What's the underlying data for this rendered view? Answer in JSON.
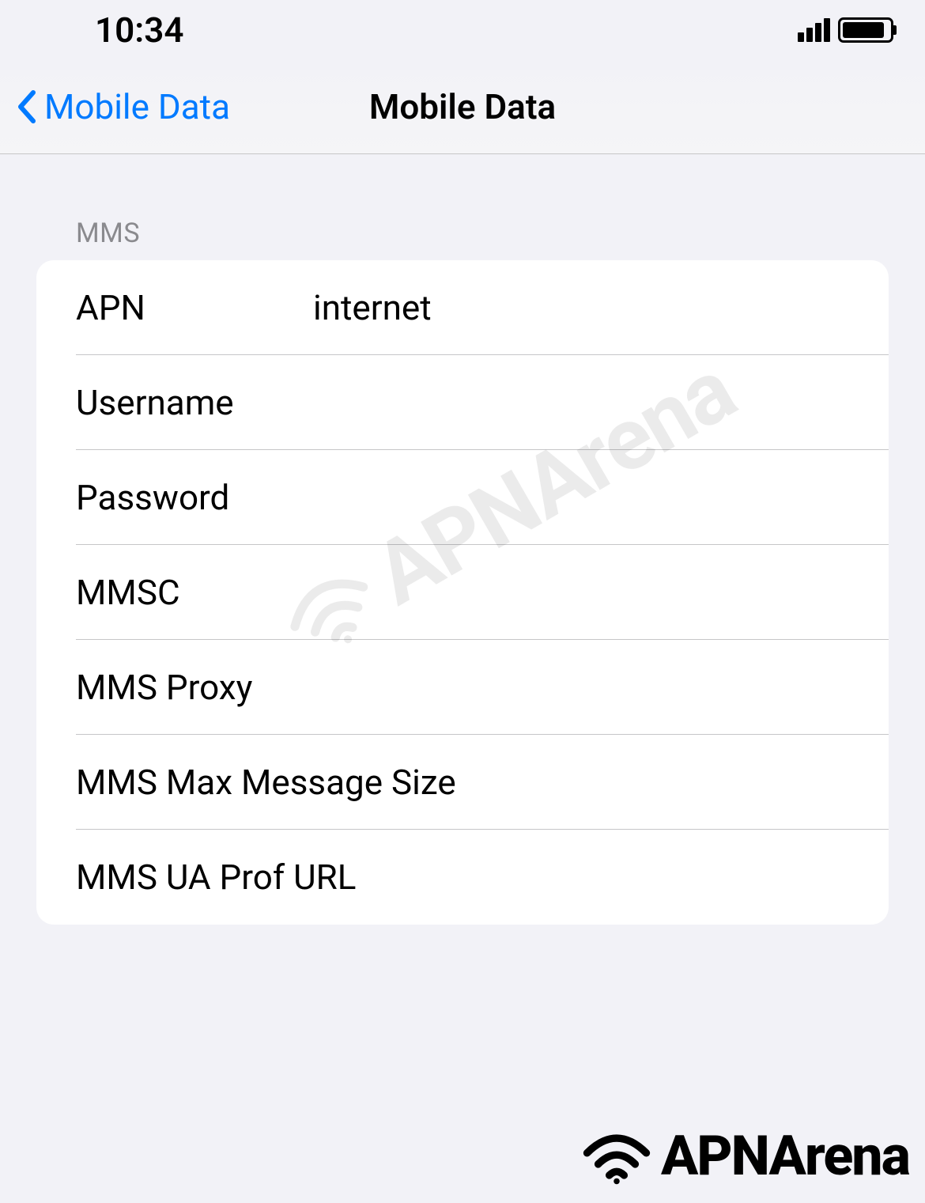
{
  "status_bar": {
    "time": "10:34"
  },
  "nav": {
    "back_label": "Mobile Data",
    "title": "Mobile Data"
  },
  "section": {
    "header": "MMS",
    "rows": [
      {
        "label": "APN",
        "value": "internet"
      },
      {
        "label": "Username",
        "value": ""
      },
      {
        "label": "Password",
        "value": ""
      },
      {
        "label": "MMSC",
        "value": ""
      },
      {
        "label": "MMS Proxy",
        "value": ""
      },
      {
        "label": "MMS Max Message Size",
        "value": ""
      },
      {
        "label": "MMS UA Prof URL",
        "value": ""
      }
    ]
  },
  "watermark": {
    "text": "APNArena"
  },
  "footer": {
    "brand": "APNArena"
  }
}
